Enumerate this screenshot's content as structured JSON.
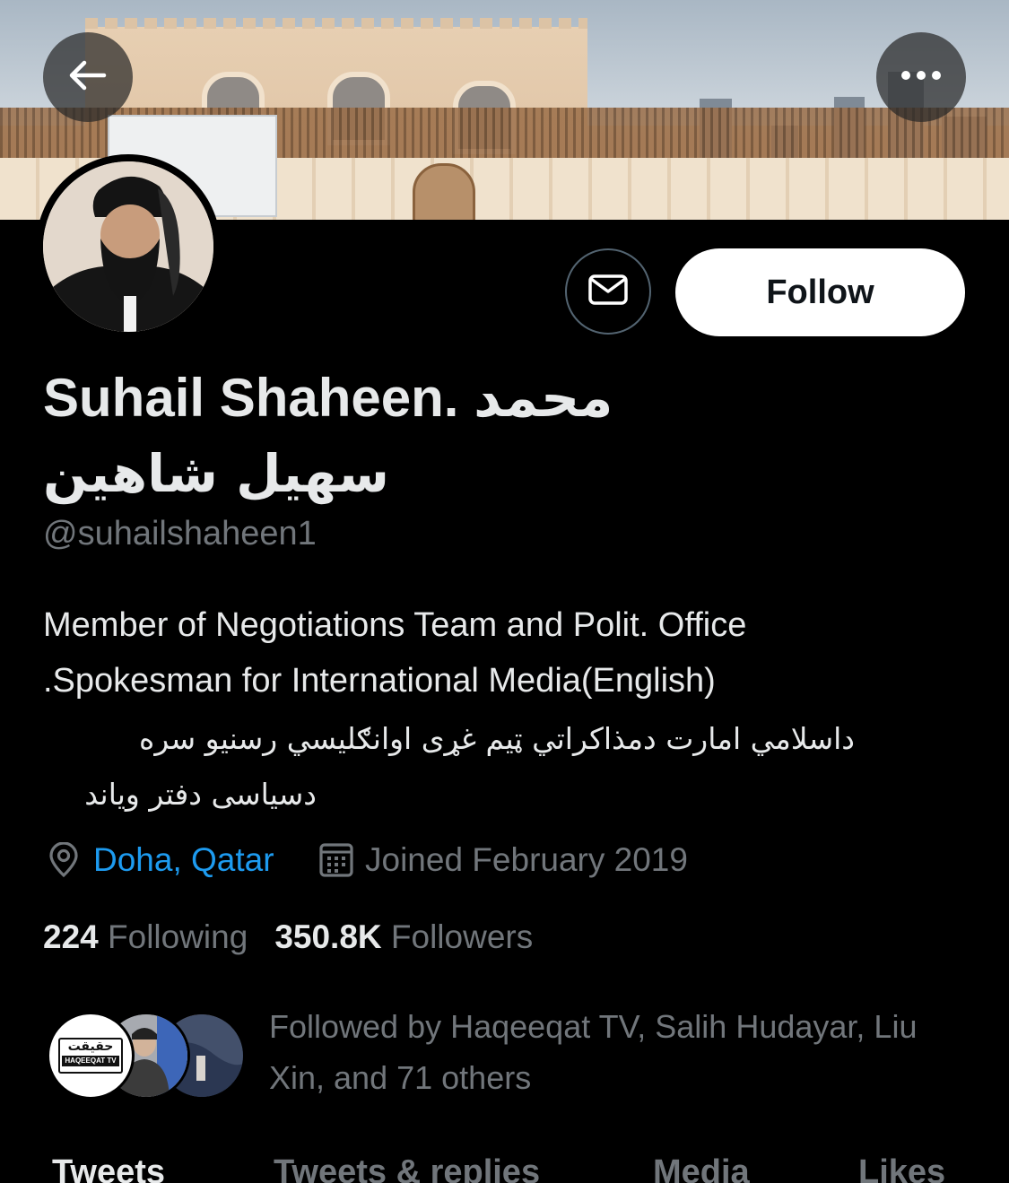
{
  "profile": {
    "display_name": "Suhail Shaheen. محمد",
    "display_name_line2": "سهیل شاهین",
    "handle": "@suhailshaheen1",
    "bio": [
      "Member of Negotiations Team and Polit. Office",
      ".Spokesman for International Media(English)",
      "داسلامي امارت دمذاكراتي ټيم غړی اوانګليسي رسنيو سره",
      "دسیاسی دفتر ویاند"
    ],
    "location": "Doha, Qatar",
    "joined": "Joined February 2019"
  },
  "actions": {
    "follow_label": "Follow"
  },
  "stats": {
    "following_count": "224",
    "following_label": "Following",
    "followers_count": "350.8K",
    "followers_label": "Followers"
  },
  "followed_by": {
    "text": "Followed by Haqeeqat TV, Salih Hudayar, Liu Xin, and 71 others",
    "badge_arabic": "حقیقت",
    "badge_latin": "HAQEEQAT TV"
  },
  "tabs": [
    {
      "label": "Tweets",
      "active": true
    },
    {
      "label": "Tweets & replies",
      "active": false
    },
    {
      "label": "Media",
      "active": false
    },
    {
      "label": "Likes",
      "active": false
    }
  ],
  "icons": {
    "back": "arrow-left-icon",
    "more": "more-horizontal-icon",
    "message": "envelope-icon",
    "location": "map-pin-icon",
    "calendar": "calendar-icon"
  },
  "colors": {
    "background": "#000000",
    "link": "#1d9bf0",
    "secondary_text": "#71767b",
    "primary_text": "#e7e9ea"
  }
}
